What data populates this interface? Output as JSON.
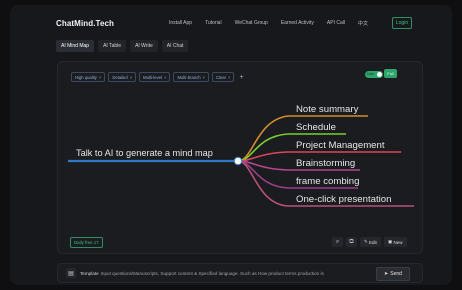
{
  "app": {
    "brand": "ChatMind.Tech"
  },
  "nav": {
    "items": [
      "Install App",
      "Tutorial",
      "WeChat Group",
      "Earned Activity",
      "API Call",
      "中文"
    ],
    "login": "Login"
  },
  "tabs": [
    "AI Mind Map",
    "AI Table",
    "AI Write",
    "AI Chat"
  ],
  "active_tab": "AI Mind Map",
  "filters": {
    "chips": [
      "High quality",
      "Detailed",
      "Multi-level",
      "Multi-branch",
      "Clear"
    ],
    "add_icon": "+"
  },
  "toggle": {
    "state_label": "Dark",
    "button_label": "Full"
  },
  "mindmap": {
    "root": "Talk to AI to generate a mind map",
    "branches": [
      {
        "label": "Note summary",
        "color": "#d38c2e"
      },
      {
        "label": "Schedule",
        "color": "#7bcf2f"
      },
      {
        "label": "Project Management",
        "color": "#d9485a"
      },
      {
        "label": "Brainstorming",
        "color": "#b5468b"
      },
      {
        "label": "frame combing",
        "color": "#9a3f86"
      },
      {
        "label": "One-click presentation",
        "color": "#b8507a"
      }
    ],
    "root_line_color": "#2f79c8"
  },
  "footer_actions": {
    "daily_free": "Daily free 17",
    "edit": "Edit",
    "new": "New"
  },
  "prompt": {
    "template_label": "Template",
    "placeholder": "Input questions/Manuscripts, Support content & Specified language. Such as How product terms production is",
    "send": "Send"
  },
  "icons": {
    "zoom": "zoom-icon",
    "copy": "copy-icon",
    "edit": "edit-icon",
    "new": "new-icon",
    "template": "template-icon",
    "send": "send-icon",
    "close": "close-icon",
    "add": "add-icon"
  }
}
